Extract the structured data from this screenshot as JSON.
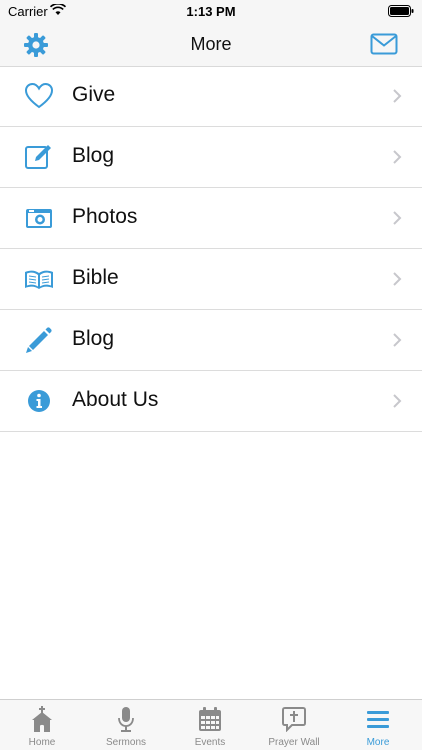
{
  "status_bar": {
    "carrier": "Carrier",
    "time": "1:13 PM"
  },
  "nav": {
    "title": "More",
    "left_icon": "gear-icon",
    "right_icon": "envelope-icon"
  },
  "accent_color": "#3a9bd8",
  "menu": {
    "items": [
      {
        "label": "Give",
        "icon": "heart-icon"
      },
      {
        "label": "Blog",
        "icon": "edit-icon"
      },
      {
        "label": "Photos",
        "icon": "camera-icon"
      },
      {
        "label": "Bible",
        "icon": "open-book-icon"
      },
      {
        "label": "Blog",
        "icon": "pencil-icon"
      },
      {
        "label": "About Us",
        "icon": "info-icon"
      }
    ]
  },
  "tab_bar": {
    "tabs": [
      {
        "label": "Home",
        "icon": "church-icon",
        "active": false
      },
      {
        "label": "Sermons",
        "icon": "microphone-icon",
        "active": false
      },
      {
        "label": "Events",
        "icon": "calendar-icon",
        "active": false
      },
      {
        "label": "Prayer Wall",
        "icon": "prayer-bubble-icon",
        "active": false
      },
      {
        "label": "More",
        "icon": "menu-icon",
        "active": true
      }
    ]
  }
}
